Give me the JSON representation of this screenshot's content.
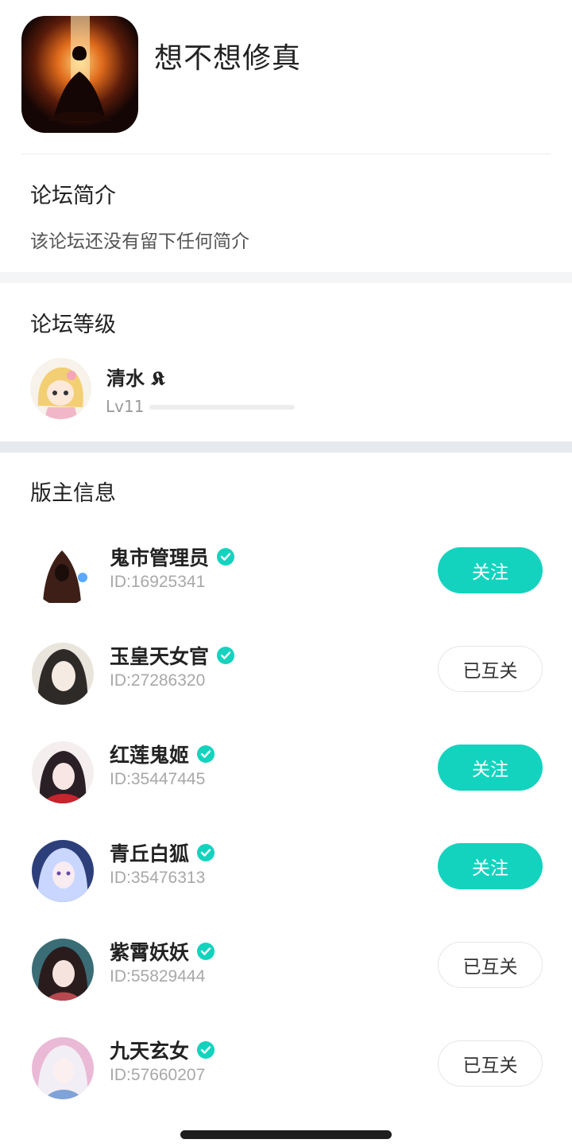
{
  "forum": {
    "name": "想不想修真"
  },
  "intro": {
    "title": "论坛简介",
    "text": "该论坛还没有留下任何简介"
  },
  "level": {
    "title": "论坛等级",
    "name": "清水 𝕶",
    "level_label": "Lv11",
    "progress": 0.0
  },
  "moderators": {
    "title": "版主信息",
    "items": [
      {
        "name": "鬼市管理员",
        "id": "ID:16925341",
        "button": "关注",
        "state": "follow"
      },
      {
        "name": "玉皇天女官",
        "id": "ID:27286320",
        "button": "已互关",
        "state": "mutual"
      },
      {
        "name": "红莲鬼姬",
        "id": "ID:35447445",
        "button": "关注",
        "state": "follow"
      },
      {
        "name": "青丘白狐",
        "id": "ID:35476313",
        "button": "关注",
        "state": "follow"
      },
      {
        "name": "紫霄妖妖",
        "id": "ID:55829444",
        "button": "已互关",
        "state": "mutual"
      },
      {
        "name": "九天玄女",
        "id": "ID:57660207",
        "button": "已互关",
        "state": "mutual"
      }
    ]
  },
  "colors": {
    "accent": "#13d3be",
    "band": "#f3f5f7",
    "band_dark": "#e6e9ee"
  },
  "icons": {
    "verified": "verified-badge-icon"
  }
}
